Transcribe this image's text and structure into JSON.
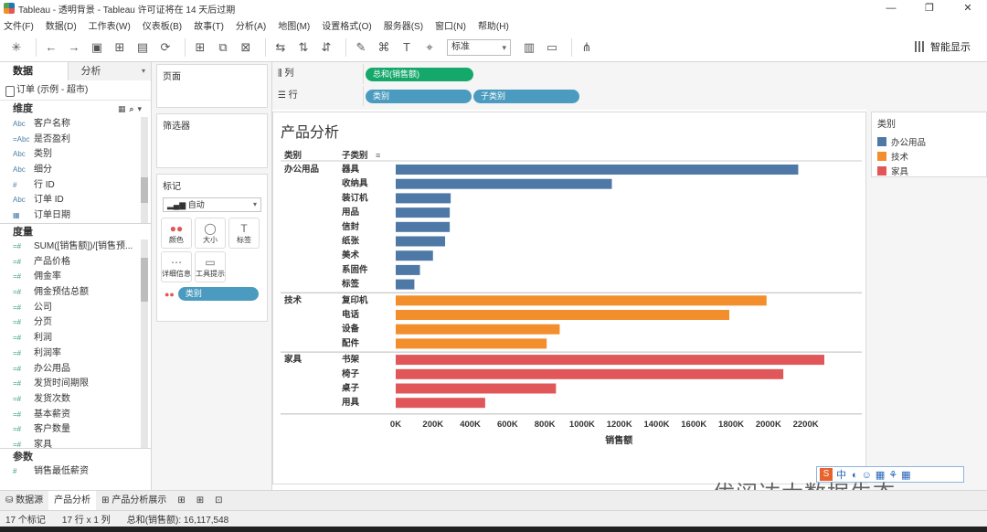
{
  "window": {
    "title": "Tableau - 透明背景 - Tableau 许可证将在 14 天后过期",
    "controls": [
      "—",
      "❐",
      "✕"
    ]
  },
  "menu": [
    "文件(F)",
    "数据(D)",
    "工作表(W)",
    "仪表板(B)",
    "故事(T)",
    "分析(A)",
    "地图(M)",
    "设置格式(O)",
    "服务器(S)",
    "窗口(N)",
    "帮助(H)"
  ],
  "toolbar": {
    "fit": "标准",
    "show_me": "智能显示"
  },
  "left": {
    "tabs": [
      "数据",
      "分析"
    ],
    "datasource": "订单 (示例 - 超市)",
    "dimensions_label": "维度",
    "dimensions": [
      {
        "icon": "Abc",
        "name": "客户名称"
      },
      {
        "icon": "=Abc",
        "name": "是否盈利"
      },
      {
        "icon": "Abc",
        "name": "类别"
      },
      {
        "icon": "Abc",
        "name": "细分"
      },
      {
        "icon": "#",
        "name": "行 ID"
      },
      {
        "icon": "Abc",
        "name": "订单 ID"
      },
      {
        "icon": "▦",
        "name": "订单日期"
      }
    ],
    "measures_label": "度量",
    "measures": [
      "SUM([销售额])/[销售预...",
      "产品价格",
      "佣金率",
      "佣金预估总额",
      "公司",
      "分页",
      "利润",
      "利润率",
      "办公用品",
      "发货时间期限",
      "发货次数",
      "基本薪资",
      "客户数量",
      "家具"
    ],
    "params_label": "参数",
    "params": [
      "销售最低薪资"
    ]
  },
  "mid": {
    "pages": "页面",
    "filters": "筛选器",
    "marks": "标记",
    "mark_type": "自动",
    "mark_buttons": [
      {
        "icon": "●●",
        "label": "颜色"
      },
      {
        "icon": "◯",
        "label": "大小"
      },
      {
        "icon": "T",
        "label": "标签"
      },
      {
        "icon": "⋯",
        "label": "详细信息"
      },
      {
        "icon": "▭",
        "label": "工具提示"
      }
    ],
    "color_pill": "类别"
  },
  "shelves": {
    "columns_label": "列",
    "columns_pill": "总和(销售额)",
    "rows_label": "行",
    "rows_pills": [
      "类别",
      "子类别"
    ]
  },
  "viz": {
    "title": "产品分析",
    "header_category": "类别",
    "header_subcategory": "子类别"
  },
  "chart_data": {
    "type": "bar",
    "title": "产品分析",
    "xlabel": "销售额",
    "ylabel": "",
    "xlim": [
      0,
      2300000
    ],
    "x_ticks": [
      "0K",
      "200K",
      "400K",
      "600K",
      "800K",
      "1000K",
      "1200K",
      "1400K",
      "1600K",
      "1800K",
      "2000K",
      "2200K"
    ],
    "groups": [
      {
        "name": "办公用品",
        "color": "#4e79a7",
        "items": [
          {
            "label": "器具",
            "value": 2160000
          },
          {
            "label": "收纳具",
            "value": 1160000
          },
          {
            "label": "装订机",
            "value": 295000
          },
          {
            "label": "用品",
            "value": 290000
          },
          {
            "label": "信封",
            "value": 290000
          },
          {
            "label": "纸张",
            "value": 265000
          },
          {
            "label": "美术",
            "value": 200000
          },
          {
            "label": "系固件",
            "value": 130000
          },
          {
            "label": "标签",
            "value": 100000
          }
        ]
      },
      {
        "name": "技术",
        "color": "#f28e2b",
        "items": [
          {
            "label": "复印机",
            "value": 1990000
          },
          {
            "label": "电话",
            "value": 1790000
          },
          {
            "label": "设备",
            "value": 880000
          },
          {
            "label": "配件",
            "value": 810000
          }
        ]
      },
      {
        "name": "家具",
        "color": "#e15759",
        "items": [
          {
            "label": "书架",
            "value": 2300000
          },
          {
            "label": "椅子",
            "value": 2080000
          },
          {
            "label": "桌子",
            "value": 860000
          },
          {
            "label": "用具",
            "value": 480000
          }
        ]
      }
    ],
    "legend": {
      "title": "类别",
      "position": "right",
      "items": [
        {
          "label": "办公用品",
          "color": "#4e79a7"
        },
        {
          "label": "技术",
          "color": "#f28e2b"
        },
        {
          "label": "家具",
          "color": "#e15759"
        }
      ]
    }
  },
  "bottom": {
    "tabs": [
      "数据源",
      "产品分析",
      "产品分析展示"
    ]
  },
  "status": {
    "marks": "17 个标记",
    "dims": "17 行 x 1 列",
    "sum": "总和(销售额): 16,117,548"
  },
  "watermark": "优阅达大数据生态",
  "ime": "中"
}
